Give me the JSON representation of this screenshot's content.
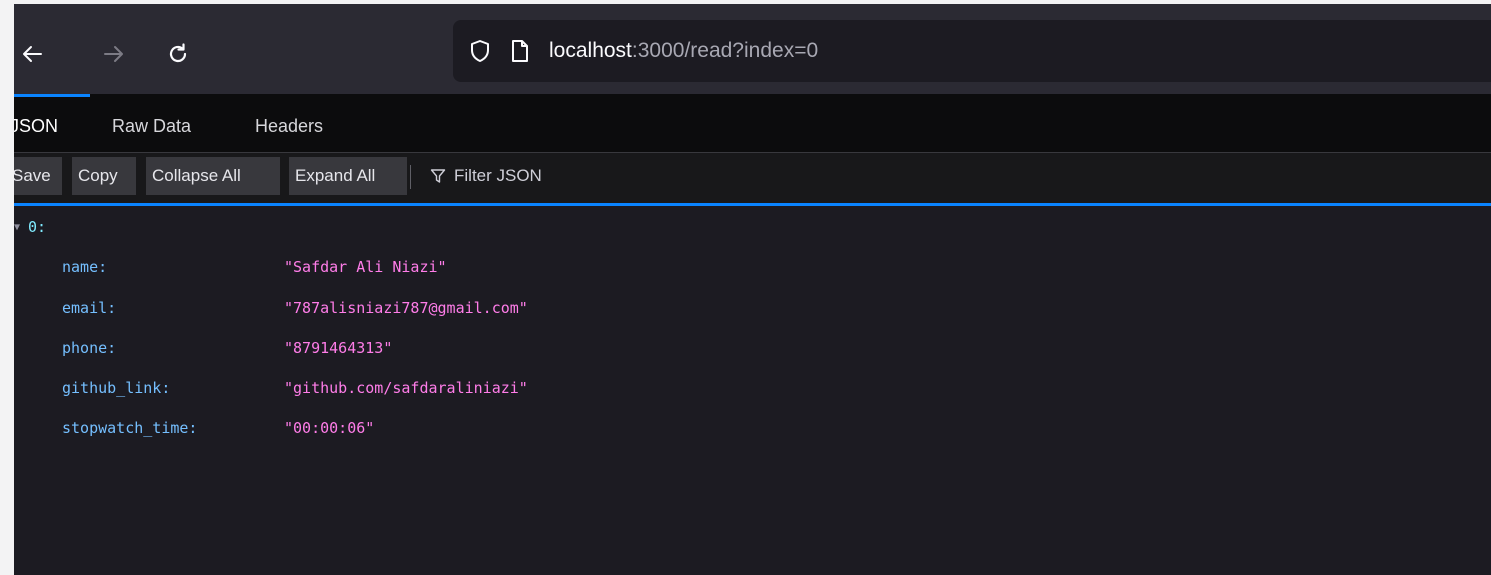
{
  "browser": {
    "address": {
      "host": "localhost",
      "path": ":3000/read?index=0"
    },
    "icons": {
      "back": "arrow-left-icon",
      "forward": "arrow-right-icon",
      "reload": "reload-icon",
      "tracking": "shield-icon",
      "page": "page-icon"
    }
  },
  "viewer": {
    "tabs": [
      {
        "label": "JSON",
        "active": true
      },
      {
        "label": "Raw Data",
        "active": false
      },
      {
        "label": "Headers",
        "active": false
      }
    ],
    "toolbar": {
      "save": "Save",
      "copy": "Copy",
      "collapse_all": "Collapse All",
      "expand_all": "Expand All",
      "filter_placeholder": "Filter JSON"
    },
    "json": {
      "root_key": "0:",
      "rows": [
        {
          "key": "name:",
          "value": "\"Safdar Ali Niazi\""
        },
        {
          "key": "email:",
          "value": "\"787alisniazi787@gmail.com\""
        },
        {
          "key": "phone:",
          "value": "\"8791464313\""
        },
        {
          "key": "github_link:",
          "value": "\"github.com/safdaraliniazi\""
        },
        {
          "key": "stopwatch_time:",
          "value": "\"00:00:06\""
        }
      ]
    }
  },
  "colors": {
    "accent": "#0a84ff",
    "json_key": "#75bfff",
    "json_string": "#ff7de9",
    "root_key": "#80ebff"
  }
}
